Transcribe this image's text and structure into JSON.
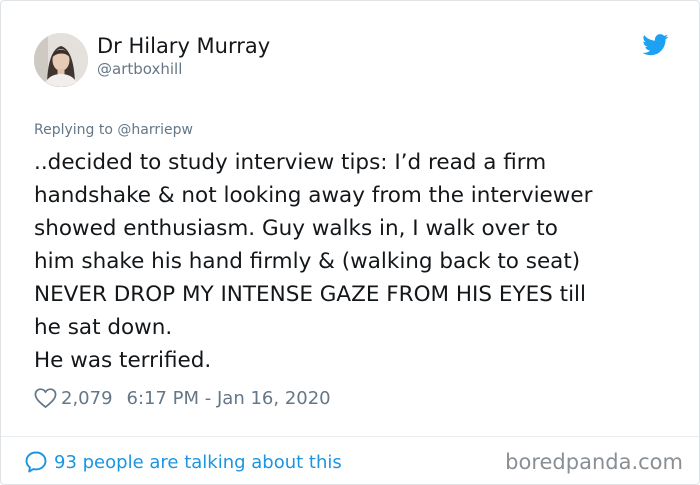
{
  "author": {
    "display_name": "Dr Hilary Murray",
    "handle": "@artboxhill",
    "avatar_icon": "profile-photo",
    "platform_icon": "twitter-bird-icon",
    "platform_color": "#1da1f2"
  },
  "reply_context": "Replying to @harriepw",
  "tweet": {
    "lines": [
      "..decided to study interview tips: I’d read a firm",
      "handshake & not looking away from the interviewer",
      "showed enthusiasm. Guy walks in, I walk over to",
      "him shake his hand firmly & (walking back to seat)",
      "NEVER DROP MY INTENSE GAZE FROM HIS EYES till",
      "he sat down.",
      "He was terrified."
    ]
  },
  "meta": {
    "like_icon": "heart-outline-icon",
    "likes": "2,079",
    "timestamp": "6:17 PM - Jan 16, 2020"
  },
  "footer": {
    "talk_icon": "speech-bubble-icon",
    "talk_text": "93 people are talking about this",
    "link_color": "#1b95e0"
  },
  "watermark": "boredpanda.com"
}
